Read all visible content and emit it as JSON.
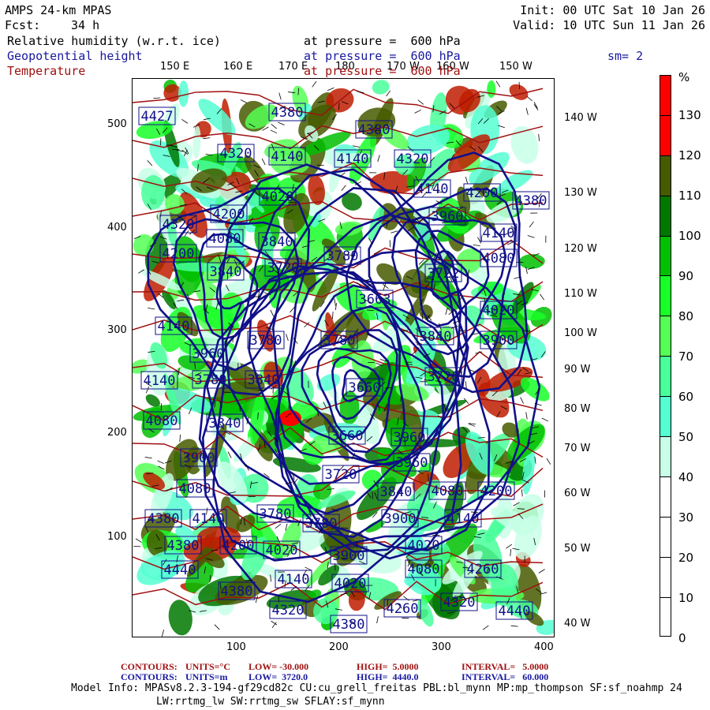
{
  "header": {
    "model": "AMPS 24-km MPAS",
    "fcst_label": "Fcst:",
    "fcst_value": "34 h",
    "init": "Init: 00 UTC Sat 10 Jan 26",
    "valid": "Valid: 10 UTC Sun 11 Jan 26"
  },
  "fields": [
    {
      "name": "Relative humidity (w.r.t. ice)",
      "level": "at pressure =  600 hPa"
    },
    {
      "name": "Geopotential height",
      "level": "at pressure =  600 hPa"
    },
    {
      "name": "Temperature",
      "level": "at pressure =  600 hPa"
    }
  ],
  "smoothing": "sm= 2",
  "colors": {
    "height_contour": "#10108a",
    "temp_contour": "#a01010"
  },
  "chart_data": {
    "type": "heatmap",
    "title": "Relative humidity (w.r.t. ice), Geopotential height, Temperature at 600 hPa",
    "top_lon_labels": [
      "150 E",
      "160 E",
      "170 E",
      "180",
      "170 W",
      "160 W",
      "150 W"
    ],
    "right_lon_labels": [
      "140 W",
      "130 W",
      "120 W",
      "110 W",
      "100 W",
      "90 W",
      "80 W",
      "70 W",
      "60 W",
      "50 W",
      "40 W"
    ],
    "x_ticks": [
      "100",
      "200",
      "300",
      "400"
    ],
    "y_ticks": [
      "500",
      "400",
      "300",
      "200",
      "100"
    ],
    "colorbar": {
      "unit": "%",
      "labels": [
        "130",
        "120",
        "110",
        "100",
        "90",
        "80",
        "70",
        "60",
        "50",
        "40",
        "30",
        "20",
        "10",
        "0"
      ],
      "colors": [
        "#ff0000",
        "#ff0000",
        "#c01c00",
        "#465a00",
        "#007800",
        "#00c000",
        "#18ff28",
        "#55ff55",
        "#48ff9a",
        "#55ffd2",
        "#c8ffe8",
        "#ffffff",
        "#ffffff",
        "#ffffff",
        "#ffffff"
      ]
    },
    "height_contour_labels": [
      "4427",
      "4380",
      "4380",
      "4320",
      "4140",
      "4140",
      "4320",
      "4140",
      "4200",
      "4380",
      "4020",
      "4200",
      "4320",
      "4080",
      "3840",
      "4200",
      "3960",
      "4140",
      "3780",
      "4080",
      "3840",
      "3720",
      "3722",
      "3663",
      "4020",
      "4140",
      "3780",
      "3780",
      "3840",
      "3900",
      "3960",
      "3780",
      "3840",
      "4140",
      "3660",
      "3720",
      "4080",
      "3840",
      "3660",
      "3960",
      "3900",
      "3720",
      "3960",
      "4080",
      "3840",
      "4080",
      "4200",
      "3780",
      "4380",
      "4140",
      "3780",
      "3900",
      "4140",
      "4380",
      "4200",
      "4020",
      "3900",
      "4020",
      "4440",
      "4080",
      "4260",
      "4380",
      "4140",
      "4020",
      "4320",
      "4260",
      "4320",
      "4440",
      "4380"
    ]
  },
  "footer": {
    "temp": {
      "contours": "CONTOURS:",
      "units": "UNITS=°C",
      "low": "LOW= -30.000",
      "high": "HIGH=  5.0000",
      "interval": "INTERVAL=   5.0000"
    },
    "height": {
      "contours": "CONTOURS:",
      "units": "UNITS=m",
      "low": "LOW=  3720.0",
      "high": "HIGH=  4440.0",
      "interval": "INTERVAL=   60.000"
    },
    "model_info": "Model Info: MPASv8.2.3-194-gf29cd82c CU:cu_grell_freitas PBL:bl_mynn MP:mp_thompson SF:sf_noahmp 24",
    "model_info2": "LW:rrtmg_lw SW:rrtmg_sw SFLAY:sf_mynn"
  }
}
